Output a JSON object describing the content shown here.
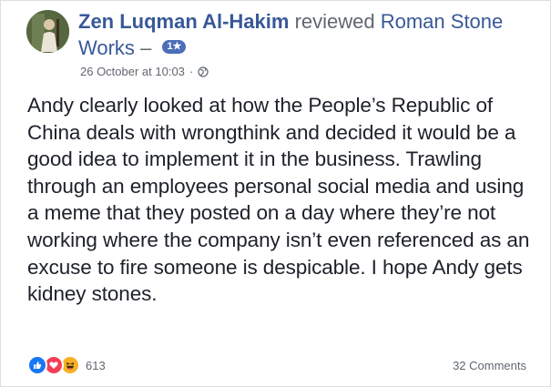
{
  "post": {
    "author": "Zen Luqman Al-Hakim",
    "action": "reviewed",
    "page": "Roman Stone Works",
    "dash": "–",
    "rating_badge": "1★",
    "timestamp": "26 October at 10:03",
    "separator": "·",
    "privacy_icon": "globe-icon",
    "text": "Andy clearly looked at how the People’s Republic of China deals with wrongthink and decided it would be a good idea to implement it in the business. Trawling through an employees personal social media and using a meme that they posted on a day where they’re not working where the company isn’t even referenced as an excuse to fire someone is despicable. I hope Andy gets kidney stones."
  },
  "footer": {
    "reactions": [
      "like-icon",
      "love-icon",
      "haha-icon"
    ],
    "reaction_count": "613",
    "comments_label": "32 Comments"
  },
  "colors": {
    "link": "#385898",
    "like": "#1877f2",
    "love": "#f33e58",
    "haha": "#f7b125",
    "badge": "#4b6eb8"
  }
}
